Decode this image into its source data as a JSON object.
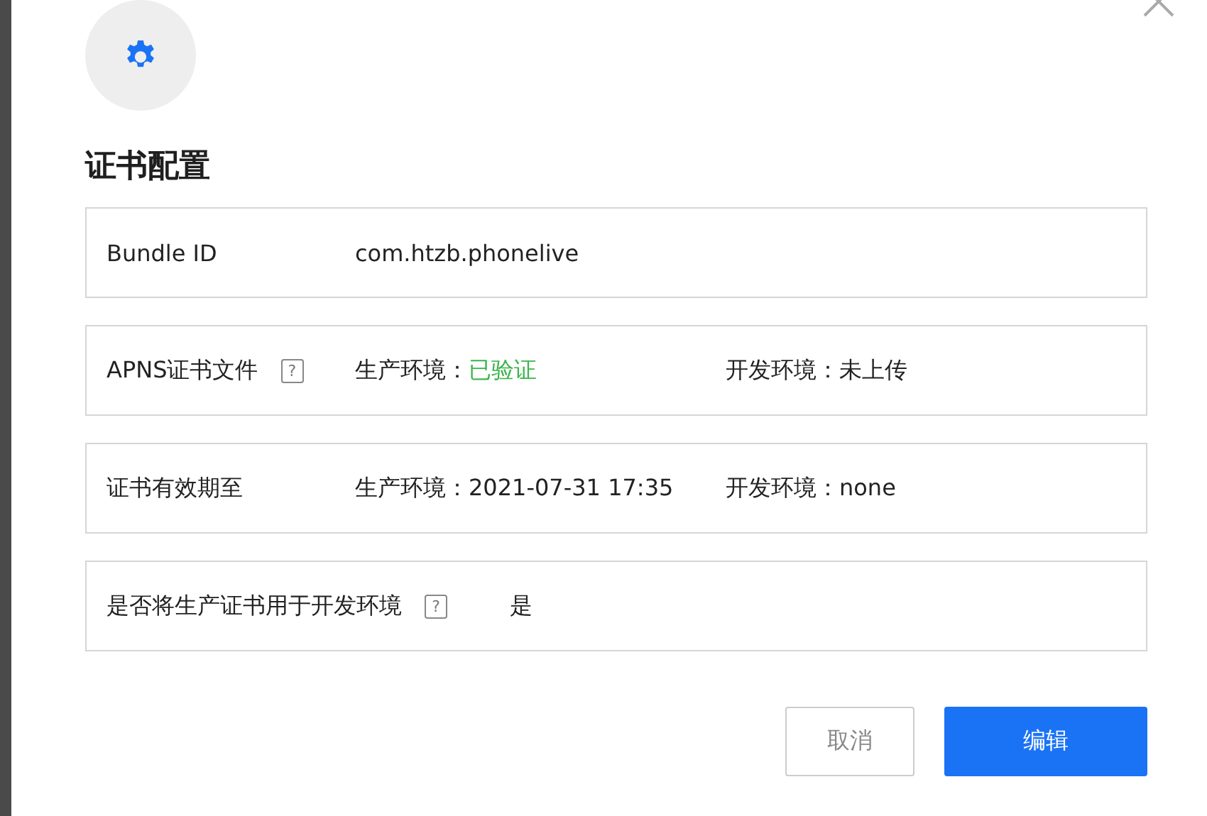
{
  "title": "证书配置",
  "rows": [
    {
      "label": "Bundle ID",
      "items": [
        {
          "text": "com.htzb.phonelive"
        }
      ]
    },
    {
      "label": "APNS证书文件",
      "help": "?",
      "items": [
        {
          "text": "生产环境：",
          "value": "已验证",
          "verified": true
        },
        {
          "text": "开发环境：",
          "value": "未上传",
          "verified": false
        }
      ]
    },
    {
      "label": "证书有效期至",
      "items": [
        {
          "text": "生产环境：",
          "value": "2021-07-31 17:35",
          "verified": false
        },
        {
          "text": "开发环境：",
          "value": "none",
          "verified": false
        }
      ]
    },
    {
      "label": "是否将生产证书用于开发环境",
      "help": "?",
      "items": [
        {
          "text": "是"
        }
      ]
    }
  ],
  "buttons": [
    {
      "label": "取消",
      "kind": "secondary"
    },
    {
      "label": "编辑",
      "kind": "primary"
    }
  ]
}
